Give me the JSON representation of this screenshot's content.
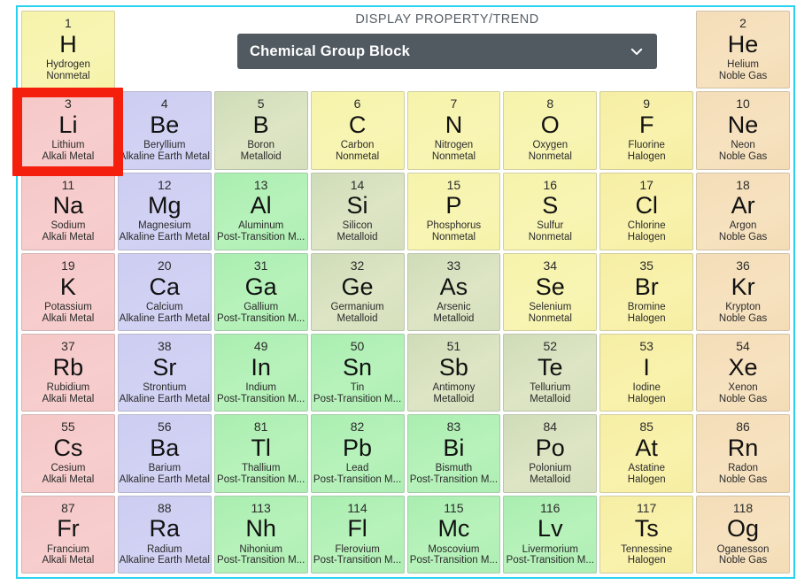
{
  "control": {
    "label": "DISPLAY PROPERTY/TREND",
    "selected": "Chemical Group Block",
    "chevron_icon": "chevron-down-icon"
  },
  "colors": {
    "frame_border": "#28d2f0",
    "select_background": "#515a61",
    "select_text": "#ffffff",
    "selection_box": "#f41f0c",
    "alkali_metal": "#f6c9c9",
    "alkaline_earth_metal": "#cecef2",
    "post_transition_metal": "#aeeeb3",
    "metalloid": "#d6e0bd",
    "nonmetal": "#f5f2a8",
    "halogen": "#f5eda0",
    "noble_gas": "#f3dcb5"
  },
  "selection": {
    "element_symbol": "Li",
    "element_name": "Lithium",
    "atomic_number": "3"
  },
  "legend_categories": [
    "Alkali Metal",
    "Alkaline Earth Metal",
    "Post-Transition M...",
    "Metalloid",
    "Nonmetal",
    "Halogen",
    "Noble Gas"
  ],
  "grid": {
    "columns": 8,
    "rows": 7,
    "cells": [
      {
        "num": "1",
        "sym": "H",
        "name": "Hydrogen",
        "group": "Nonmetal",
        "cat": "nonmetal"
      },
      {
        "empty": true
      },
      {
        "empty": true
      },
      {
        "empty": true
      },
      {
        "empty": true
      },
      {
        "empty": true
      },
      {
        "empty": true
      },
      {
        "num": "2",
        "sym": "He",
        "name": "Helium",
        "group": "Noble Gas",
        "cat": "noble"
      },
      {
        "num": "3",
        "sym": "Li",
        "name": "Lithium",
        "group": "Alkali Metal",
        "cat": "alkali"
      },
      {
        "num": "4",
        "sym": "Be",
        "name": "Beryllium",
        "group": "Alkaline Earth Metal",
        "cat": "alkaline"
      },
      {
        "num": "5",
        "sym": "B",
        "name": "Boron",
        "group": "Metalloid",
        "cat": "metalloid"
      },
      {
        "num": "6",
        "sym": "C",
        "name": "Carbon",
        "group": "Nonmetal",
        "cat": "nonmetal"
      },
      {
        "num": "7",
        "sym": "N",
        "name": "Nitrogen",
        "group": "Nonmetal",
        "cat": "nonmetal"
      },
      {
        "num": "8",
        "sym": "O",
        "name": "Oxygen",
        "group": "Nonmetal",
        "cat": "nonmetal"
      },
      {
        "num": "9",
        "sym": "F",
        "name": "Fluorine",
        "group": "Halogen",
        "cat": "halogen"
      },
      {
        "num": "10",
        "sym": "Ne",
        "name": "Neon",
        "group": "Noble Gas",
        "cat": "noble"
      },
      {
        "num": "11",
        "sym": "Na",
        "name": "Sodium",
        "group": "Alkali Metal",
        "cat": "alkali"
      },
      {
        "num": "12",
        "sym": "Mg",
        "name": "Magnesium",
        "group": "Alkaline Earth Metal",
        "cat": "alkaline"
      },
      {
        "num": "13",
        "sym": "Al",
        "name": "Aluminum",
        "group": "Post-Transition M...",
        "cat": "posttrans"
      },
      {
        "num": "14",
        "sym": "Si",
        "name": "Silicon",
        "group": "Metalloid",
        "cat": "metalloid"
      },
      {
        "num": "15",
        "sym": "P",
        "name": "Phosphorus",
        "group": "Nonmetal",
        "cat": "nonmetal"
      },
      {
        "num": "16",
        "sym": "S",
        "name": "Sulfur",
        "group": "Nonmetal",
        "cat": "nonmetal"
      },
      {
        "num": "17",
        "sym": "Cl",
        "name": "Chlorine",
        "group": "Halogen",
        "cat": "halogen"
      },
      {
        "num": "18",
        "sym": "Ar",
        "name": "Argon",
        "group": "Noble Gas",
        "cat": "noble"
      },
      {
        "num": "19",
        "sym": "K",
        "name": "Potassium",
        "group": "Alkali Metal",
        "cat": "alkali"
      },
      {
        "num": "20",
        "sym": "Ca",
        "name": "Calcium",
        "group": "Alkaline Earth Metal",
        "cat": "alkaline"
      },
      {
        "num": "31",
        "sym": "Ga",
        "name": "Gallium",
        "group": "Post-Transition M...",
        "cat": "posttrans"
      },
      {
        "num": "32",
        "sym": "Ge",
        "name": "Germanium",
        "group": "Metalloid",
        "cat": "metalloid"
      },
      {
        "num": "33",
        "sym": "As",
        "name": "Arsenic",
        "group": "Metalloid",
        "cat": "metalloid"
      },
      {
        "num": "34",
        "sym": "Se",
        "name": "Selenium",
        "group": "Nonmetal",
        "cat": "nonmetal"
      },
      {
        "num": "35",
        "sym": "Br",
        "name": "Bromine",
        "group": "Halogen",
        "cat": "halogen"
      },
      {
        "num": "36",
        "sym": "Kr",
        "name": "Krypton",
        "group": "Noble Gas",
        "cat": "noble"
      },
      {
        "num": "37",
        "sym": "Rb",
        "name": "Rubidium",
        "group": "Alkali Metal",
        "cat": "alkali"
      },
      {
        "num": "38",
        "sym": "Sr",
        "name": "Strontium",
        "group": "Alkaline Earth Metal",
        "cat": "alkaline"
      },
      {
        "num": "49",
        "sym": "In",
        "name": "Indium",
        "group": "Post-Transition M...",
        "cat": "posttrans"
      },
      {
        "num": "50",
        "sym": "Sn",
        "name": "Tin",
        "group": "Post-Transition M...",
        "cat": "posttrans"
      },
      {
        "num": "51",
        "sym": "Sb",
        "name": "Antimony",
        "group": "Metalloid",
        "cat": "metalloid"
      },
      {
        "num": "52",
        "sym": "Te",
        "name": "Tellurium",
        "group": "Metalloid",
        "cat": "metalloid"
      },
      {
        "num": "53",
        "sym": "I",
        "name": "Iodine",
        "group": "Halogen",
        "cat": "halogen"
      },
      {
        "num": "54",
        "sym": "Xe",
        "name": "Xenon",
        "group": "Noble Gas",
        "cat": "noble"
      },
      {
        "num": "55",
        "sym": "Cs",
        "name": "Cesium",
        "group": "Alkali Metal",
        "cat": "alkali"
      },
      {
        "num": "56",
        "sym": "Ba",
        "name": "Barium",
        "group": "Alkaline Earth Metal",
        "cat": "alkaline"
      },
      {
        "num": "81",
        "sym": "Tl",
        "name": "Thallium",
        "group": "Post-Transition M...",
        "cat": "posttrans"
      },
      {
        "num": "82",
        "sym": "Pb",
        "name": "Lead",
        "group": "Post-Transition M...",
        "cat": "posttrans"
      },
      {
        "num": "83",
        "sym": "Bi",
        "name": "Bismuth",
        "group": "Post-Transition M...",
        "cat": "posttrans"
      },
      {
        "num": "84",
        "sym": "Po",
        "name": "Polonium",
        "group": "Metalloid",
        "cat": "metalloid"
      },
      {
        "num": "85",
        "sym": "At",
        "name": "Astatine",
        "group": "Halogen",
        "cat": "halogen"
      },
      {
        "num": "86",
        "sym": "Rn",
        "name": "Radon",
        "group": "Noble Gas",
        "cat": "noble"
      },
      {
        "num": "87",
        "sym": "Fr",
        "name": "Francium",
        "group": "Alkali Metal",
        "cat": "alkali"
      },
      {
        "num": "88",
        "sym": "Ra",
        "name": "Radium",
        "group": "Alkaline Earth Metal",
        "cat": "alkaline"
      },
      {
        "num": "113",
        "sym": "Nh",
        "name": "Nihonium",
        "group": "Post-Transition M...",
        "cat": "posttrans"
      },
      {
        "num": "114",
        "sym": "Fl",
        "name": "Flerovium",
        "group": "Post-Transition M...",
        "cat": "posttrans"
      },
      {
        "num": "115",
        "sym": "Mc",
        "name": "Moscovium",
        "group": "Post-Transition M...",
        "cat": "posttrans"
      },
      {
        "num": "116",
        "sym": "Lv",
        "name": "Livermorium",
        "group": "Post-Transition M...",
        "cat": "posttrans"
      },
      {
        "num": "117",
        "sym": "Ts",
        "name": "Tennessine",
        "group": "Halogen",
        "cat": "halogen"
      },
      {
        "num": "118",
        "sym": "Og",
        "name": "Oganesson",
        "group": "Noble Gas",
        "cat": "noble"
      }
    ]
  }
}
